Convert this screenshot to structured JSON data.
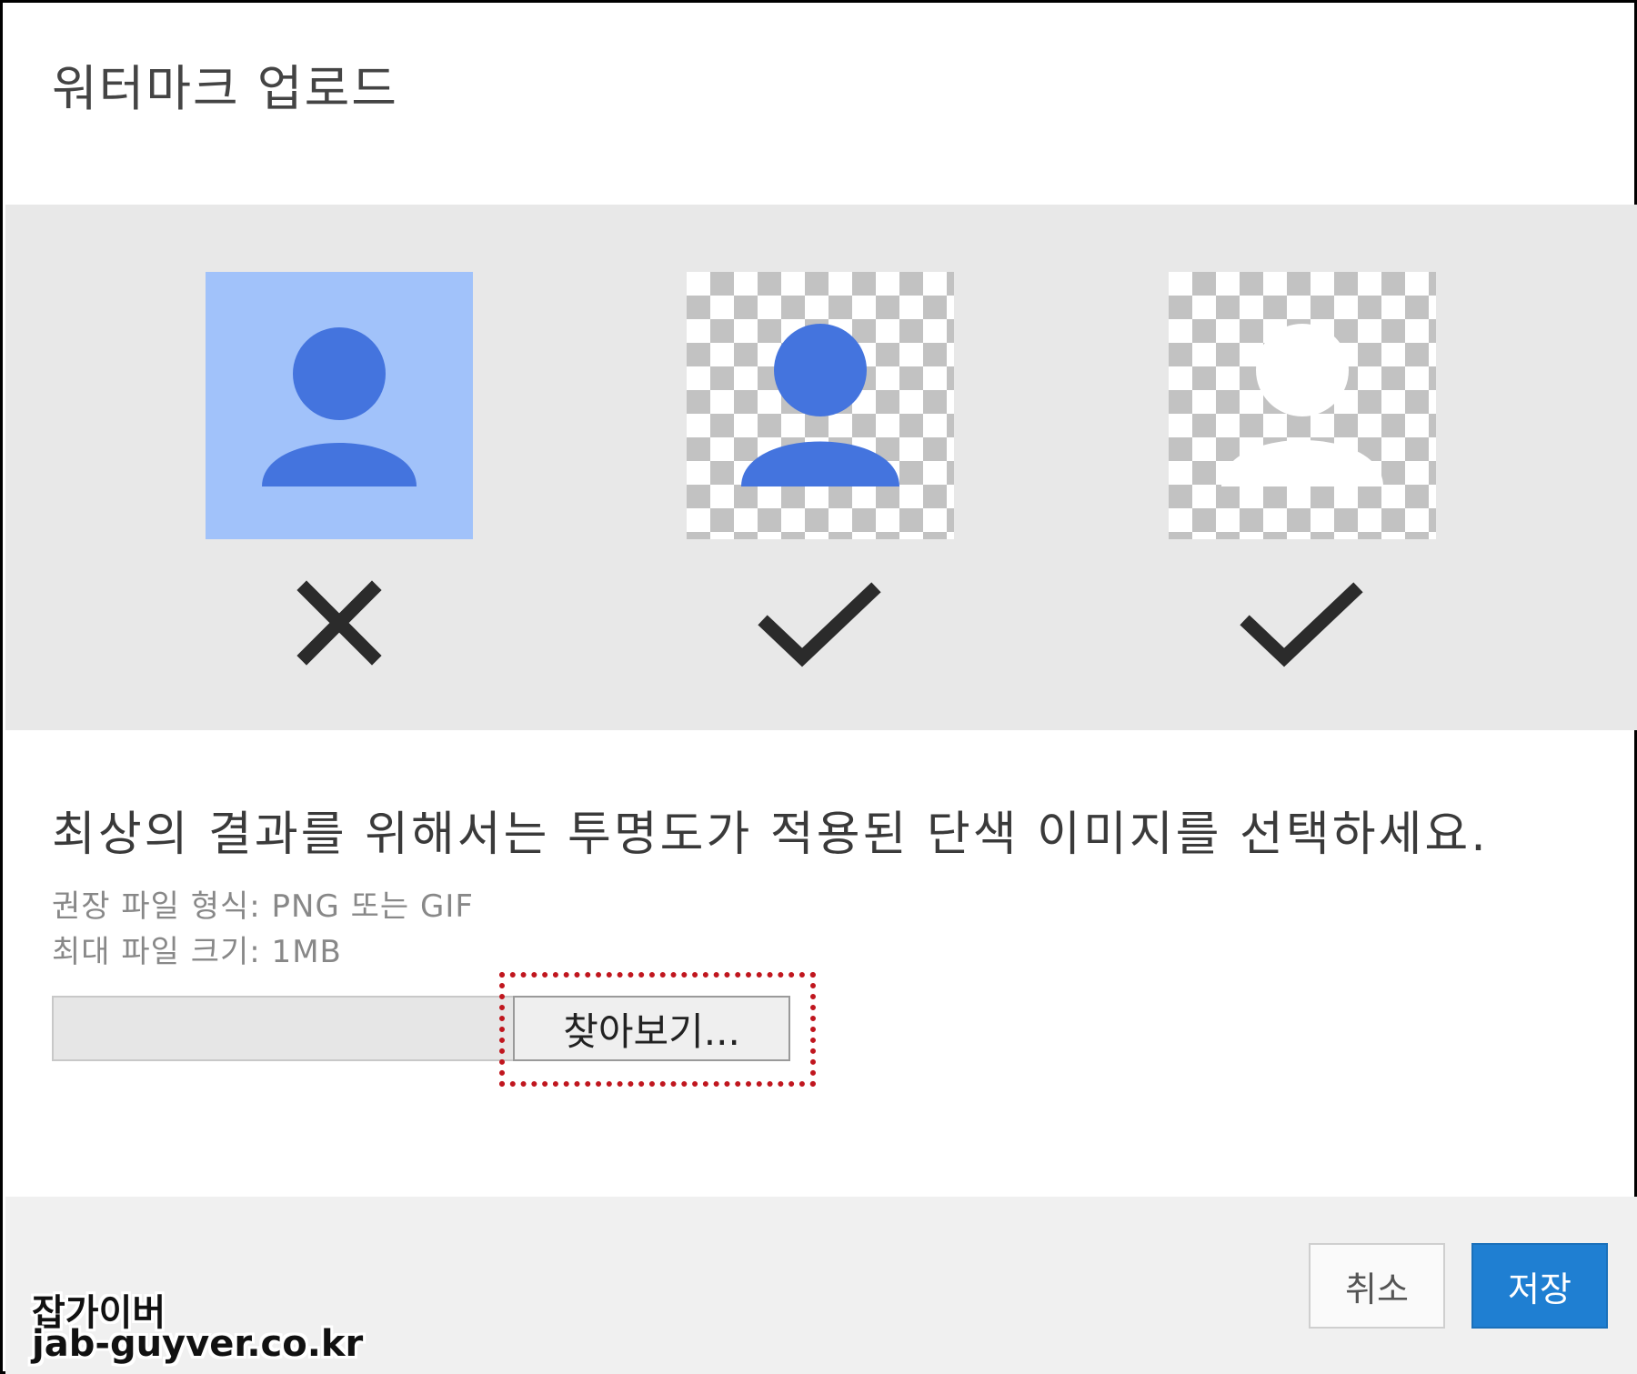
{
  "dialog": {
    "title": "워터마크 업로드"
  },
  "examples": [
    {
      "name": "solid-background-image",
      "result": "x-icon",
      "background": "#a1c2fa",
      "figure_color": "#4474de"
    },
    {
      "name": "transparent-colored-image",
      "result": "check-icon",
      "background": "checkerboard",
      "figure_color": "#4474de"
    },
    {
      "name": "transparent-white-image",
      "result": "check-icon",
      "background": "checkerboard",
      "figure_color": "#ffffff"
    }
  ],
  "instructions": {
    "main": "최상의 결과를 위해서는 투명도가 적용된 단색 이미지를 선택하세요.",
    "format": "권장 파일 형식: PNG 또는 GIF",
    "size": "최대 파일 크기: 1MB"
  },
  "upload": {
    "file_value": "",
    "browse_label": "찾아보기..."
  },
  "footer": {
    "cancel_label": "취소",
    "save_label": "저장"
  },
  "watermark": {
    "line1": "잡가이버",
    "line2": "jab-guyver.co.kr"
  },
  "colors": {
    "accent": "#1f7fd2",
    "highlight": "#c0161e",
    "panel": "#e8e8e8",
    "mark": "#2b2b2b"
  }
}
